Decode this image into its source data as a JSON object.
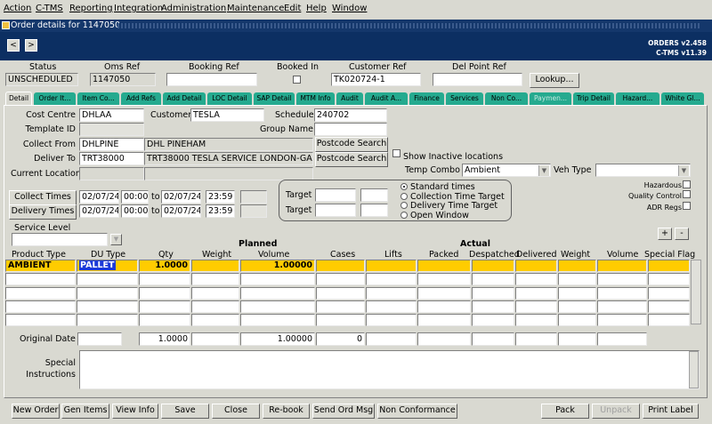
{
  "menu": [
    "Action",
    "C-TMS",
    "Reporting",
    "Integration",
    "Administration",
    "Maintenance",
    "Edit",
    "Help",
    "Window"
  ],
  "window_title": "Order details for 1147050",
  "header": {
    "prev": "<",
    "next": ">",
    "version1": "ORDERS v2.458",
    "version2": "C-TMS v11.39"
  },
  "top": {
    "status_label": "Status",
    "status_value": "UNSCHEDULED",
    "oms_ref_label": "Oms Ref",
    "oms_ref_value": "1147050",
    "booking_ref_label": "Booking Ref",
    "booking_ref_value": "",
    "booked_in_label": "Booked In",
    "customer_ref_label": "Customer Ref",
    "customer_ref_value": "TK020724-1",
    "del_point_ref_label": "Del Point Ref",
    "del_point_ref_value": "",
    "lookup_label": "Lookup..."
  },
  "tabs": [
    "Detail",
    "Order It...",
    "Item Co...",
    "Add Refs",
    "Add Detail",
    "LOC Detail",
    "SAP Detail",
    "MTM Info",
    "Audit",
    "Audit A...",
    "Finance",
    "Services",
    "Non Co...",
    "Paymen...",
    "Trip Detail",
    "Hazard...",
    "White Gl..."
  ],
  "detail": {
    "cost_centre_label": "Cost Centre",
    "cost_centre": "DHLAA",
    "customer_label": "Customer",
    "customer": "TESLA",
    "schedule_label": "Schedule",
    "schedule": "240702",
    "template_id_label": "Template ID",
    "group_name_label": "Group Name",
    "collect_from_label": "Collect From",
    "collect_from_code": "DHLPINE",
    "collect_from_name": "DHL PINEHAM",
    "deliver_to_label": "Deliver To",
    "deliver_to_code": "TRT38000",
    "deliver_to_name": "TRT38000 TESLA SERVICE LONDON-GA",
    "postcode_search": "Postcode Search",
    "show_inactive": "Show Inactive locations",
    "current_location_label": "Current Location",
    "temp_combo_label": "Temp Combo",
    "temp_combo": "Ambient",
    "veh_type_label": "Veh Type",
    "veh_type": ""
  },
  "times": {
    "collect_btn": "Collect Times",
    "delivery_btn": "Delivery Times",
    "to": "to",
    "collect": {
      "from_date": "02/07/24",
      "from_time": "00:00",
      "to_date": "02/07/24",
      "to_time": "23:59"
    },
    "delivery": {
      "from_date": "02/07/24",
      "from_time": "00:00",
      "to_date": "02/07/24",
      "to_time": "23:59"
    },
    "target_label": "Target",
    "radio": [
      "Standard times",
      "Collection Time Target",
      "Delivery Time Target",
      "Open Window"
    ],
    "radio_selected": 0
  },
  "flags": {
    "hazardous": "Hazardous",
    "quality_control": "Quality Control",
    "adr_regs": "ADR Regs"
  },
  "service_level_label": "Service Level",
  "plus": "+",
  "minus": "-",
  "grid": {
    "planned_label": "Planned",
    "actual_label": "Actual",
    "columns": [
      "Product Type",
      "DU Type",
      "Qty",
      "Weight",
      "Volume",
      "Cases",
      "Lifts",
      "Packed",
      "Despatched",
      "Delivered",
      "Weight",
      "Volume",
      "Special Flag"
    ],
    "rows": [
      [
        "AMBIENT",
        "PALLET",
        "1.0000",
        "",
        "1.00000",
        "",
        "",
        "",
        "",
        "",
        "",
        "",
        ""
      ]
    ]
  },
  "totals": {
    "original_date_label": "Original Date",
    "qty": "1.0000",
    "volume": "1.00000",
    "cases": "0"
  },
  "special_instructions_label1": "Special",
  "special_instructions_label2": "Instructions",
  "buttons": {
    "new_order": "New Order",
    "gen_items": "Gen Items",
    "view_info": "View Info",
    "save": "Save",
    "close": "Close",
    "rebook": "Re-book",
    "send_ord_msg": "Send Ord Msg",
    "non_conformance": "Non Conformance",
    "pack": "Pack",
    "unpack": "Unpack",
    "print_label": "Print Label"
  }
}
